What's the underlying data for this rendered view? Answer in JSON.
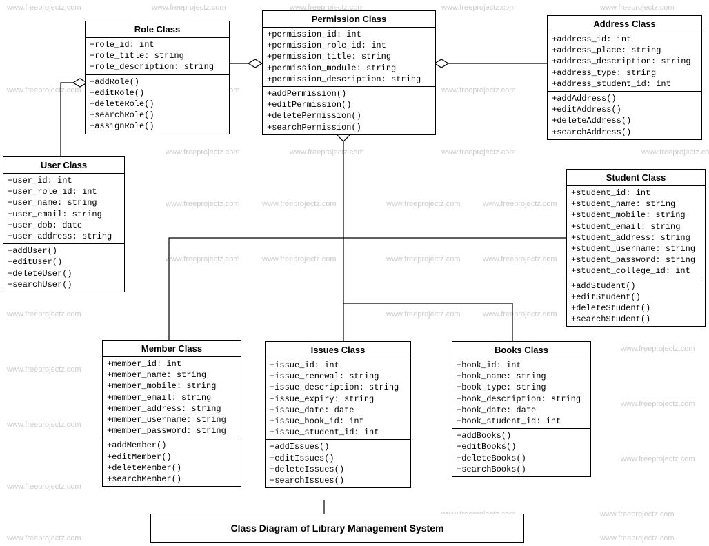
{
  "diagram_title": "Class Diagram of Library Management System",
  "watermark_text": "www.freeprojectz.com",
  "classes": {
    "role": {
      "title": "Role Class",
      "attrs": [
        "+role_id: int",
        "+role_title: string",
        "+role_description: string"
      ],
      "ops": [
        "+addRole()",
        "+editRole()",
        "+deleteRole()",
        "+searchRole()",
        "+assignRole()"
      ]
    },
    "permission": {
      "title": "Permission Class",
      "attrs": [
        "+permission_id: int",
        "+permission_role_id: int",
        "+permission_title: string",
        "+permission_module: string",
        "+permission_description: string"
      ],
      "ops": [
        "+addPermission()",
        "+editPermission()",
        "+deletePermission()",
        "+searchPermission()"
      ]
    },
    "address": {
      "title": "Address Class",
      "attrs": [
        "+address_id: int",
        "+address_place: string",
        "+address_description: string",
        "+address_type: string",
        "+address_student_id: int"
      ],
      "ops": [
        "+addAddress()",
        "+editAddress()",
        "+deleteAddress()",
        "+searchAddress()"
      ]
    },
    "user": {
      "title": "User Class",
      "attrs": [
        "+user_id: int",
        "+user_role_id: int",
        "+user_name: string",
        "+user_email: string",
        "+user_dob: date",
        "+user_address: string"
      ],
      "ops": [
        "+addUser()",
        "+editUser()",
        "+deleteUser()",
        "+searchUser()"
      ]
    },
    "student": {
      "title": "Student Class",
      "attrs": [
        "+student_id: int",
        "+student_name: string",
        "+student_mobile: string",
        "+student_email: string",
        "+student_address: string",
        "+student_username: string",
        "+student_password: string",
        "+student_college_id: int"
      ],
      "ops": [
        "+addStudent()",
        "+editStudent()",
        "+deleteStudent()",
        "+searchStudent()"
      ]
    },
    "member": {
      "title": "Member Class",
      "attrs": [
        "+member_id: int",
        "+member_name: string",
        "+member_mobile: string",
        "+member_email: string",
        "+member_address: string",
        "+member_username: string",
        "+member_password: string"
      ],
      "ops": [
        "+addMember()",
        "+editMember()",
        "+deleteMember()",
        "+searchMember()"
      ]
    },
    "issues": {
      "title": "Issues Class",
      "attrs": [
        "+issue_id: int",
        "+issue_renewal: string",
        "+issue_description: string",
        "+issue_expiry: string",
        "+issue_date: date",
        "+issue_book_id: int",
        "+issue_student_id: int"
      ],
      "ops": [
        "+addIssues()",
        "+editIssues()",
        "+deleteIssues()",
        "+searchIssues()"
      ]
    },
    "books": {
      "title": "Books Class",
      "attrs": [
        "+book_id: int",
        "+book_name: string",
        "+book_type: string",
        "+book_description: string",
        "+book_date: date",
        "+book_student_id: int"
      ],
      "ops": [
        "+addBooks()",
        "+editBooks()",
        "+deleteBooks()",
        "+searchBooks()"
      ]
    }
  }
}
